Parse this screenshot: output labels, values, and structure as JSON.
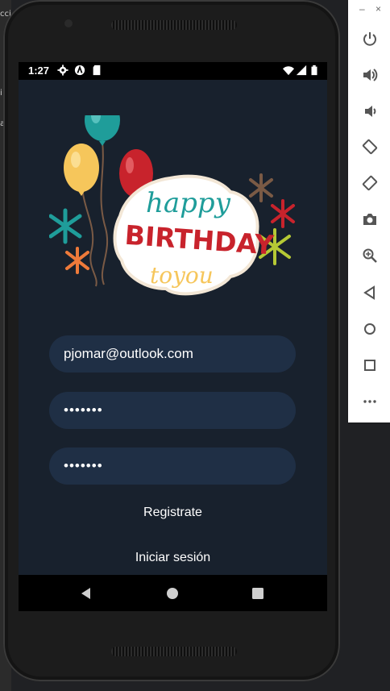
{
  "status_bar": {
    "time": "1:27",
    "left_icons": [
      "settings-icon",
      "android-auto-icon",
      "sd-card-icon"
    ],
    "right_icons": [
      "wifi-icon",
      "cell-signal-icon",
      "battery-icon"
    ]
  },
  "form": {
    "email_value": "pjomar@outlook.com",
    "password_value": "•••••••",
    "confirm_password_value": "•••••••",
    "register_label": "Registrate",
    "login_label": "Iniciar sesión"
  },
  "artwork": {
    "line1": "happy",
    "line2": "BIRTHDAY",
    "line3": "toyou"
  },
  "nav": {
    "buttons": [
      "back-icon",
      "home-icon",
      "recents-icon"
    ]
  },
  "emulator_panel": {
    "minimize": "–",
    "close": "×",
    "tools": [
      "power-icon",
      "volume-up-icon",
      "volume-down-icon",
      "rotate-left-icon",
      "rotate-right-icon",
      "camera-icon",
      "zoom-icon",
      "back-icon",
      "home-icon",
      "overview-icon",
      "more-icon"
    ]
  },
  "background": {
    "left_fragments": [
      "cci",
      "i",
      "ar"
    ]
  },
  "colors": {
    "screen_bg": "#18212d",
    "field_bg": "#1f2f45",
    "balloon_teal": "#1f9d9a",
    "balloon_yellow": "#f6c65b",
    "balloon_red": "#c8232c"
  }
}
